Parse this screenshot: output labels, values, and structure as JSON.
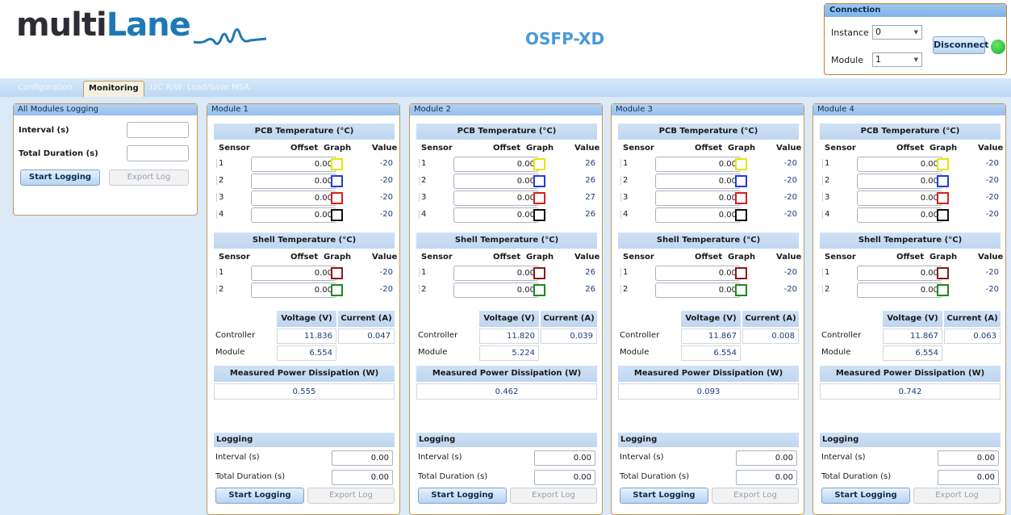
{
  "header": {
    "logo_main": "multi",
    "logo_accent": "Lane",
    "title": "OSFP-XD"
  },
  "connection": {
    "title": "Connection",
    "instance_label": "Instance",
    "instance_value": "0",
    "module_label": "Module",
    "module_value": "1",
    "disconnect_label": "Disconnect",
    "status_color": "#11b32b"
  },
  "tabs": [
    "Configuration",
    "Monitoring",
    "I2C R/W",
    "Load/Save MSA"
  ],
  "active_tab": "Monitoring",
  "all_logging": {
    "title": "All Modules Logging",
    "interval_label": "Interval (s)",
    "interval_value": "",
    "duration_label": "Total Duration (s)",
    "duration_value": "",
    "start_label": "Start Logging",
    "export_label": "Export Log"
  },
  "labels": {
    "pcb_title": "PCB Temperature (°C)",
    "shell_title": "Shell Temperature (°C)",
    "sensor": "Sensor",
    "offset": "Offset",
    "graph": "Graph",
    "value": "Value",
    "voltage": "Voltage (V)",
    "current": "Current (A)",
    "controller": "Controller",
    "module": "Module",
    "power_title": "Measured Power Dissipation (W)",
    "logging": "Logging",
    "interval": "Interval (s)",
    "duration": "Total Duration (s)",
    "start": "Start Logging",
    "export": "Export Log"
  },
  "pcb_colors": [
    "#e6e600",
    "#1f3fd6",
    "#d62020",
    "#111111"
  ],
  "shell_colors": [
    "#8b1a1a",
    "#1e8a1e"
  ],
  "modules": [
    {
      "title": "Module 1",
      "pcb": [
        {
          "sensor": "1",
          "offset": "0.00",
          "value": "-20"
        },
        {
          "sensor": "2",
          "offset": "0.00",
          "value": "-20"
        },
        {
          "sensor": "3",
          "offset": "0.00",
          "value": "-20"
        },
        {
          "sensor": "4",
          "offset": "0.00",
          "value": "-20"
        }
      ],
      "shell": [
        {
          "sensor": "1",
          "offset": "0.00",
          "value": "-20"
        },
        {
          "sensor": "2",
          "offset": "0.00",
          "value": "-20"
        }
      ],
      "controller_voltage": "11.836",
      "controller_current": "0.047",
      "module_voltage": "6.554",
      "power": "0.555",
      "log_interval": "0.00",
      "log_duration": "0.00"
    },
    {
      "title": "Module 2",
      "pcb": [
        {
          "sensor": "1",
          "offset": "0.00",
          "value": "26"
        },
        {
          "sensor": "2",
          "offset": "0.00",
          "value": "26"
        },
        {
          "sensor": "3",
          "offset": "0.00",
          "value": "27"
        },
        {
          "sensor": "4",
          "offset": "0.00",
          "value": "26"
        }
      ],
      "shell": [
        {
          "sensor": "1",
          "offset": "0.00",
          "value": "26"
        },
        {
          "sensor": "2",
          "offset": "0.00",
          "value": "26"
        }
      ],
      "controller_voltage": "11.820",
      "controller_current": "0.039",
      "module_voltage": "5.224",
      "power": "0.462",
      "log_interval": "0.00",
      "log_duration": "0.00"
    },
    {
      "title": "Module 3",
      "pcb": [
        {
          "sensor": "1",
          "offset": "0.00",
          "value": "-20"
        },
        {
          "sensor": "2",
          "offset": "0.00",
          "value": "-20"
        },
        {
          "sensor": "3",
          "offset": "0.00",
          "value": "-20"
        },
        {
          "sensor": "4",
          "offset": "0.00",
          "value": "-20"
        }
      ],
      "shell": [
        {
          "sensor": "1",
          "offset": "0.00",
          "value": "-20"
        },
        {
          "sensor": "2",
          "offset": "0.00",
          "value": "-20"
        }
      ],
      "controller_voltage": "11.867",
      "controller_current": "0.008",
      "module_voltage": "6.554",
      "power": "0.093",
      "log_interval": "0.00",
      "log_duration": "0.00"
    },
    {
      "title": "Module 4",
      "pcb": [
        {
          "sensor": "1",
          "offset": "0.00",
          "value": "-20"
        },
        {
          "sensor": "2",
          "offset": "0.00",
          "value": "-20"
        },
        {
          "sensor": "3",
          "offset": "0.00",
          "value": "-20"
        },
        {
          "sensor": "4",
          "offset": "0.00",
          "value": "-20"
        }
      ],
      "shell": [
        {
          "sensor": "1",
          "offset": "0.00",
          "value": "-20"
        },
        {
          "sensor": "2",
          "offset": "0.00",
          "value": "-20"
        }
      ],
      "controller_voltage": "11.867",
      "controller_current": "0.063",
      "module_voltage": "6.554",
      "power": "0.742",
      "log_interval": "0.00",
      "log_duration": "0.00"
    }
  ]
}
